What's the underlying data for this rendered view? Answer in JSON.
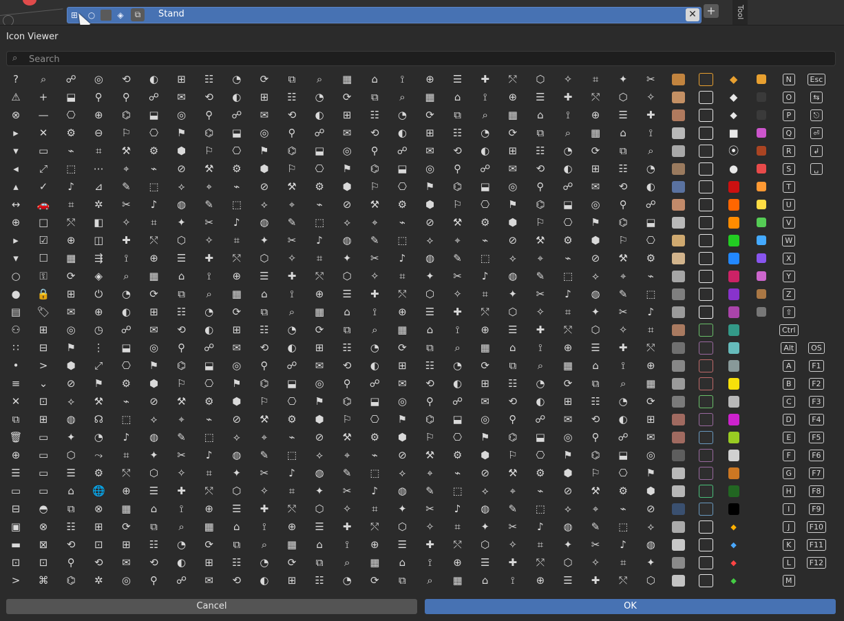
{
  "top_bar": {
    "object_name": "Stand",
    "add_label": "+",
    "close_label": "✕",
    "side_tab_label": "Tool"
  },
  "dialog": {
    "title": "Icon Viewer",
    "search_placeholder": "Search",
    "cancel_label": "Cancel",
    "ok_label": "OK"
  },
  "icon_grid": {
    "columns": 30,
    "rows": 29,
    "glyph_pool": [
      "◎",
      "⌕",
      "✦",
      "⚙",
      "⟲",
      "⊕",
      "✎",
      "⚑",
      "◔",
      "⬡",
      "⌁",
      "⚲",
      "▦",
      "✂",
      "⬢",
      "◐",
      "☰",
      "⬚",
      "⌬",
      "⟳",
      "✧",
      "⊘",
      "☍",
      "⌂",
      "♪",
      "⚐",
      "⊞",
      "✚",
      "⟡",
      "⬓",
      "⧉",
      "⌗",
      "⚒",
      "✉",
      "⟟",
      "◍",
      "⎔",
      "☷",
      "⤲",
      "⌖"
    ],
    "col0": [
      "?",
      "⚠",
      "⊗",
      "▸",
      "▾",
      "◂",
      "▴",
      "↔",
      "⊕",
      "▸",
      "▾",
      "○",
      "●",
      "▤",
      "⚇",
      "∷",
      "•",
      "≡",
      "✕",
      "⧉",
      "🗑",
      "⊕",
      "☰",
      "▭",
      "⊟",
      "▣",
      "▬",
      "⊡",
      ">"
    ],
    "col1": [
      "⌕",
      "+",
      "—",
      "✕",
      "▭",
      "⤢",
      "✓",
      "🚗",
      "□",
      "☑",
      "☐",
      "⚿",
      "🔒",
      "🏷",
      "⊞",
      "⊟",
      ">",
      "⌄",
      "⊡",
      "⊞",
      "▭",
      "▭",
      "▭",
      "▭",
      "◓",
      "⊗",
      "⊠",
      "⊡",
      "⌘"
    ],
    "col2": [
      "◎",
      "⚲",
      "⊕",
      "⊖",
      "⌗",
      "⋯",
      "⊿",
      "✲",
      "◧",
      "◫",
      "⇶",
      "◈",
      "⏻",
      "⊕",
      "◷",
      "⋮",
      "⤢",
      "⚑",
      "⚒",
      "☊",
      "◔",
      "⤳",
      "⚙",
      "🌐",
      "⊗",
      "⊞",
      "⊡",
      "⟲",
      "✲"
    ],
    "swatch_col_a": [
      "#c2843f",
      "#c49064",
      "#b07a5e",
      "#b8b8b8",
      "#a8a8a8",
      "#9a7a5e",
      "#5a72a0",
      "#c28a6a",
      "#b9b9b9",
      "#cfa970",
      "#d2b48c",
      "#a6a6a6",
      "#7f7f7f",
      "#9a9a9a",
      "#a97a60",
      "#707070",
      "#878787",
      "#9b9b9b",
      "#7a7a7a",
      "#a06a60",
      "#a06a60",
      "#5e5e5e",
      "#b9b9b9",
      "#b6b6b6",
      "#3a5070",
      "#aaaaaa",
      "#c8c8c8",
      "#8a8a8a",
      "#c3c3c3"
    ],
    "swatch_col_b": [
      "#e8a030",
      "#e8e8e8",
      "#e8e8e8",
      "#f0f0f0",
      "#e0e0e0",
      "#e8e8e8",
      "#e0e0e0",
      "#e8e8e8",
      "#e8e8e8",
      "#e8e8e8",
      "#e8e8e8",
      "#e8e8e8",
      "#e0e0e0",
      "#ffffff",
      "#6ac06a",
      "#9a6aa0",
      "#c06a6a",
      "#c06a6a",
      "#6ac06a",
      "#9a6aa0",
      "#6a9ac0",
      "#9a6aa0",
      "#9a6aa0",
      "#4ac07a",
      "#6a9ac0",
      "#e8e8e8",
      "#e8e8e8",
      "#e8e8e8",
      "#e8e8e8"
    ],
    "color_strip": [
      "#e8a030",
      "#ffffff",
      "#ffffff",
      "#ffffff",
      "#ffffff",
      "#ffffff",
      "#cc1010",
      "#ff6600",
      "#ff8c00",
      "#22cc22",
      "#2288ff",
      "#cc2266",
      "#8833cc",
      "#aa44aa",
      "#339988",
      "#66bbbb",
      "#889999",
      "#f7e00a",
      "#b8b8b8",
      "#cc22cc",
      "#99cc22",
      "#d0d0d0",
      "#cc7722",
      "#226622",
      "#000000",
      "#000000",
      "#000000",
      "#000000",
      "#000000"
    ],
    "color_strip_b": [
      "#e8a030",
      "#3a3a3a",
      "#3a3a3a",
      "#cc55cc",
      "#aa4422",
      "#e84a4a",
      "#ff9933",
      "#ffdd44",
      "#55cc55",
      "#44aaff",
      "#8855ee",
      "#cc66cc",
      "#aa7744",
      "#777777",
      "#00000000",
      "#00000000",
      "#00000000",
      "#00000000",
      "#00000000",
      "#00000000",
      "#00000000",
      "#00000000",
      "#00000000",
      "#00000000",
      "#00000000",
      "#00000000",
      "#00000000",
      "#00000000",
      "#00000000"
    ],
    "row_markers_gold": [
      "◆",
      "◆",
      "⬥",
      "■",
      "⦿",
      "●"
    ],
    "mini_markers": [
      "◆",
      "◆",
      "◆",
      "◆"
    ],
    "mini_marker_colors": [
      "#ffb000",
      "#4aa8ff",
      "#ff4444",
      "#44cc44"
    ],
    "letters": [
      "N",
      "O",
      "P",
      "Q",
      "R",
      "S",
      "T",
      "U",
      "V",
      "W",
      "X",
      "Y",
      "Z",
      "⇧",
      "Ctrl",
      "Alt",
      "A",
      "B",
      "C",
      "D",
      "E",
      "F",
      "G",
      "H",
      "I",
      "J",
      "K",
      "L",
      "M"
    ],
    "keys": [
      "Esc",
      "⇆",
      "⎋",
      "⏎",
      "↲",
      "␣",
      "",
      "",
      "",
      "",
      "",
      "",
      "",
      "",
      "",
      "OS",
      "F1",
      "F2",
      "F3",
      "F4",
      "F5",
      "F6",
      "F7",
      "F8",
      "F9",
      "F10",
      "F11",
      "F12",
      ""
    ]
  }
}
